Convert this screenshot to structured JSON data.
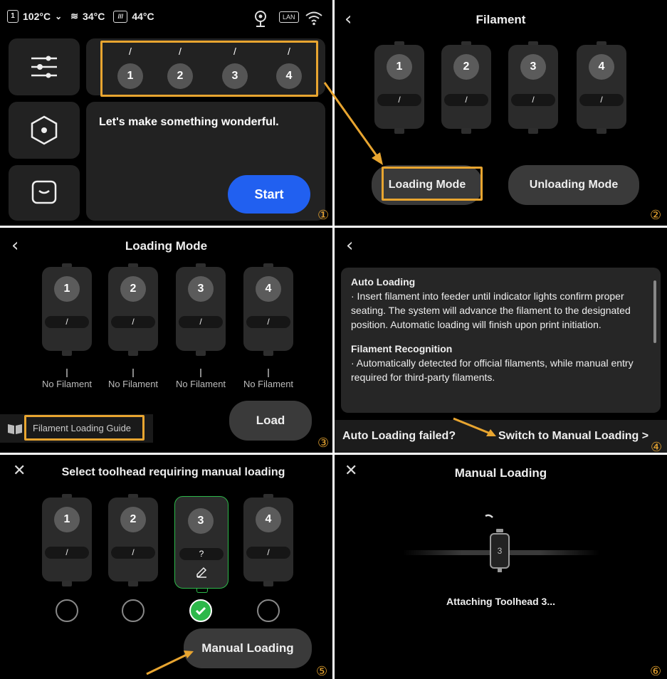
{
  "markers": {
    "p1": "①",
    "p2": "②",
    "p3": "③",
    "p4": "④",
    "p5": "⑤",
    "p6": "⑥"
  },
  "status": {
    "nozzle_badge": "1",
    "nozzle_temp": "102°C",
    "bed_temp": "34°C",
    "chamber_temp": "44°C",
    "lan_label": "LAN"
  },
  "home": {
    "slots": [
      {
        "id": "1",
        "label": "/"
      },
      {
        "id": "2",
        "label": "/"
      },
      {
        "id": "3",
        "label": "/"
      },
      {
        "id": "4",
        "label": "/"
      }
    ],
    "message": "Let's make something wonderful.",
    "start_label": "Start"
  },
  "filament": {
    "title": "Filament",
    "slots": [
      {
        "id": "1",
        "label": "/"
      },
      {
        "id": "2",
        "label": "/"
      },
      {
        "id": "3",
        "label": "/"
      },
      {
        "id": "4",
        "label": "/"
      }
    ],
    "loading_mode_label": "Loading Mode",
    "unloading_mode_label": "Unloading Mode"
  },
  "loading_mode": {
    "title": "Loading Mode",
    "slots": [
      {
        "id": "1",
        "label": "/",
        "status": "No Filament"
      },
      {
        "id": "2",
        "label": "/",
        "status": "No Filament"
      },
      {
        "id": "3",
        "label": "/",
        "status": "No Filament"
      },
      {
        "id": "4",
        "label": "/",
        "status": "No Filament"
      }
    ],
    "guide_label": "Filament Loading Guide",
    "load_label": "Load"
  },
  "guide": {
    "auto_heading": "Auto Loading",
    "auto_body": "· Insert filament into feeder until indicator lights confirm proper seating. The system will advance the filament to the designated position. Automatic loading will finish upon print initiation.",
    "recog_heading": "Filament Recognition",
    "recog_body": "· Automatically detected for official filaments, while manual entry required for third-party filaments.",
    "failed_label": "Auto Loading failed?",
    "switch_label": "Switch to Manual Loading >"
  },
  "select_toolhead": {
    "title": "Select toolhead requiring manual loading",
    "slots": [
      {
        "id": "1",
        "label": "/"
      },
      {
        "id": "2",
        "label": "/"
      },
      {
        "id": "3",
        "label": "?"
      },
      {
        "id": "4",
        "label": "/"
      }
    ],
    "selected": "3",
    "manual_loading_label": "Manual Loading"
  },
  "manual_loading": {
    "title": "Manual Loading",
    "toolhead_number": "3",
    "status": "Attaching Toolhead 3..."
  },
  "colors": {
    "accent_orange": "#e8a530",
    "start_blue": "#2160f0",
    "select_green": "#2db84a"
  }
}
